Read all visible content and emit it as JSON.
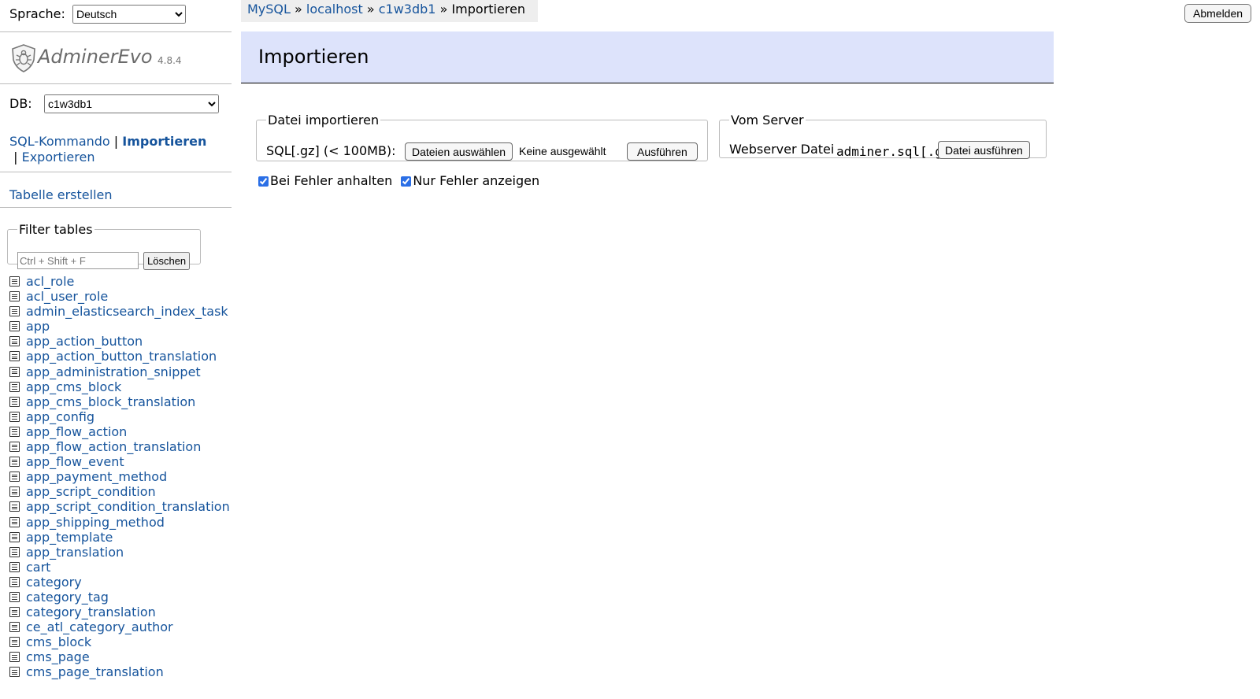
{
  "language": {
    "label": "Sprache:",
    "selected": "Deutsch"
  },
  "logo": {
    "name": "AdminerEvo",
    "version": "4.8.4"
  },
  "db": {
    "label": "DB:",
    "selected": "c1w3db1"
  },
  "links": {
    "sql": "SQL-Kommando",
    "import": "Importieren",
    "export": "Exportieren",
    "separator": "|"
  },
  "create_table": "Tabelle erstellen",
  "filter": {
    "legend": "Filter tables",
    "placeholder": "Ctrl + Shift + F",
    "clear": "Löschen"
  },
  "tables": [
    "acl_role",
    "acl_user_role",
    "admin_elasticsearch_index_task",
    "app",
    "app_action_button",
    "app_action_button_translation",
    "app_administration_snippet",
    "app_cms_block",
    "app_cms_block_translation",
    "app_config",
    "app_flow_action",
    "app_flow_action_translation",
    "app_flow_event",
    "app_payment_method",
    "app_script_condition",
    "app_script_condition_translation",
    "app_shipping_method",
    "app_template",
    "app_translation",
    "cart",
    "category",
    "category_tag",
    "category_translation",
    "ce_atl_category_author",
    "cms_block",
    "cms_page",
    "cms_page_translation"
  ],
  "breadcrumb": {
    "driver": "MySQL",
    "server": "localhost",
    "db": "c1w3db1",
    "current": "Importieren",
    "sep": "»"
  },
  "logout": "Abmelden",
  "page_title": "Importieren",
  "upload": {
    "legend": "Datei importieren",
    "label": "SQL[.gz] (< 100MB):",
    "choose": "Dateien auswählen",
    "no_file": "Keine ausgewählt",
    "execute": "Ausführen"
  },
  "server": {
    "legend": "Vom Server",
    "label": "Webserver Datei",
    "file": "adminer.sql[.gz]",
    "execute": "Datei ausführen"
  },
  "options": {
    "stop_on_error": "Bei Fehler anhalten",
    "only_errors": "Nur Fehler anzeigen"
  }
}
